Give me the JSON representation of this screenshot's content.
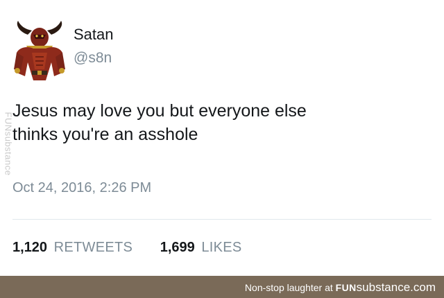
{
  "tweet": {
    "author": {
      "display_name": "Satan",
      "handle": "@s8n",
      "avatar_icon": "horned-demon-avatar"
    },
    "text_line_1": "Jesus may love you but everyone else",
    "text_line_2": "thinks you're an asshole",
    "timestamp": "Oct 24, 2016, 2:26 PM",
    "stats": {
      "retweets_count": "1,120",
      "retweets_label": "RETWEETS",
      "likes_count": "1,699",
      "likes_label": "LIKES"
    }
  },
  "watermark": {
    "side_text": "FUNsubstance",
    "footer_text": "Non-stop laughter at ",
    "footer_brand_bold": "FUN",
    "footer_brand_rest": "substance.com"
  },
  "colors": {
    "text_primary": "#14171a",
    "text_secondary": "#7d8b96",
    "divider": "#e1e8ed",
    "footer_bar": "#7a6a58"
  }
}
